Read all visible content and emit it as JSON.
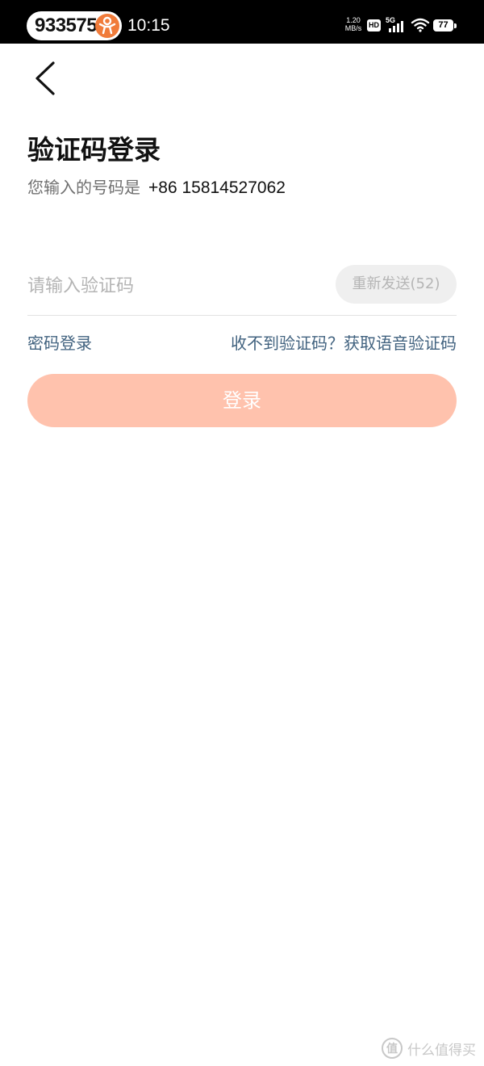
{
  "status_bar": {
    "notification_number": "933575",
    "time": "10:15",
    "net_speed_value": "1.20",
    "net_speed_unit": "MB/s",
    "hd_label": "HD",
    "network_label": "5G",
    "battery_level": "77",
    "icons": [
      "app-logo-icon",
      "signal-icon",
      "wifi-icon",
      "battery-icon"
    ]
  },
  "nav": {
    "back_icon": "chevron-left-icon"
  },
  "header": {
    "title": "验证码登录",
    "phone_hint_label": "您输入的号码是",
    "phone_number": "+86 15814527062"
  },
  "form": {
    "code_value": "",
    "code_placeholder": "请输入验证码",
    "resend_label": "重新发送(52)"
  },
  "links": {
    "password_login": "密码登录",
    "voice_code": "收不到验证码？获取语音验证码"
  },
  "actions": {
    "login_label": "登录"
  },
  "watermark": {
    "icon_glyph": "值",
    "text": "什么值得买"
  },
  "colors": {
    "status_bar_bg": "#000000",
    "app_logo": "#f07b3a",
    "link": "#41627f",
    "login_button_disabled": "#ffc2ad",
    "resend_button_bg": "#efefef",
    "placeholder": "#b4b4b4"
  }
}
